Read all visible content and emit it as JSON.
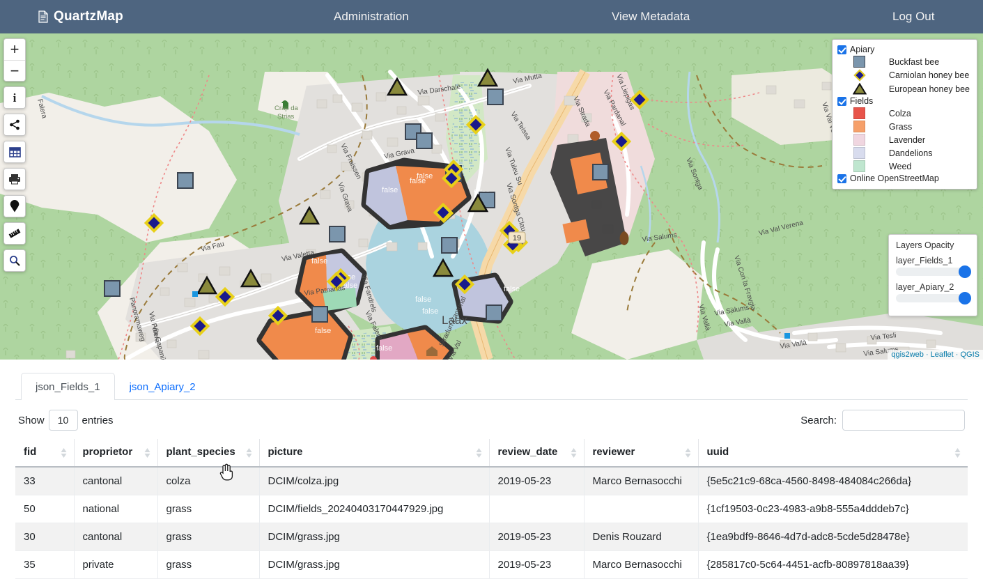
{
  "navbar": {
    "brand": "QuartzMap",
    "brand_icon": "document-icon",
    "links": [
      {
        "label": "Administration",
        "name": "nav-administration"
      },
      {
        "label": "View Metadata",
        "name": "nav-view-metadata"
      },
      {
        "label": "Log Out",
        "name": "nav-log-out"
      }
    ],
    "bg_color": "#4e6580"
  },
  "map": {
    "toolbar": [
      {
        "icon": "zoom-in-icon",
        "label": "+"
      },
      {
        "icon": "zoom-out-icon",
        "label": "−"
      },
      {
        "icon": "info-icon",
        "label": "i"
      },
      {
        "icon": "share-icon",
        "label": ""
      },
      {
        "icon": "attribute-table-icon",
        "label": ""
      },
      {
        "icon": "print-icon",
        "label": ""
      },
      {
        "icon": "marker-pin-icon",
        "label": ""
      },
      {
        "icon": "measure-ruler-icon",
        "label": ""
      },
      {
        "icon": "search-icon",
        "label": ""
      }
    ],
    "place_label": "Laax",
    "road_shield": "19",
    "feature_labels": [
      "false",
      "false",
      "false",
      "false",
      "false",
      "false",
      "false",
      "false",
      "false",
      "false",
      "false",
      "false",
      "false"
    ],
    "street_labels": [
      "Via Darschalè",
      "Via Mutta",
      "Via Teissa",
      "Via Tuleu Su",
      "Via Strada",
      "Via Liepigas",
      "Via Pardanal",
      "Via Sontga Clau",
      "Via Grava",
      "Via Fraissen",
      "Via Fandrels",
      "Via Falera",
      "Via Valetta",
      "Via Fau",
      "Via Capaniia",
      "Via Patnanas",
      "Via Crest",
      "Stradun Cantunal",
      "Via Val",
      "Via Salums",
      "Via Vallà",
      "Via Val Verena",
      "Via Con la Fravgia",
      "Via Tesli",
      "Falera",
      "Panoramaweg",
      "Crap da Strias",
      "Via Valetta",
      "Via Sontga"
    ],
    "attribution": {
      "qgis2web": "qgis2web",
      "leaflet": "Leaflet",
      "qgis": "QGIS",
      "sep": " · "
    }
  },
  "legend": {
    "groups": [
      {
        "name": "Apiary",
        "checked": true,
        "items": [
          {
            "label": "Buckfast bee",
            "symbol": "square",
            "color": "#7b96ad"
          },
          {
            "label": "Carniolan honey bee",
            "symbol": "diamond",
            "color": "#1a1a8c"
          },
          {
            "label": "European honey bee",
            "symbol": "triangle",
            "color": "#8a8a3c"
          }
        ]
      },
      {
        "name": "Fields",
        "checked": true,
        "items": [
          {
            "label": "Colza",
            "symbol": "fill",
            "color": "#e8544a"
          },
          {
            "label": "Grass",
            "symbol": "fill",
            "color": "#f6a06a"
          },
          {
            "label": "Lavender",
            "symbol": "fill",
            "color": "#f0d6e0"
          },
          {
            "label": "Dandelions",
            "symbol": "fill",
            "color": "#d8dcee"
          },
          {
            "label": "Weed",
            "symbol": "fill",
            "color": "#bfe6cf"
          }
        ]
      },
      {
        "name": "Online OpenStreetMap",
        "checked": true,
        "items": []
      }
    ],
    "checkbox_color": "#1a73e8"
  },
  "opacity_panel": {
    "title": "Layers Opacity",
    "sliders": [
      {
        "label": "layer_Fields_1",
        "value": 100
      },
      {
        "label": "layer_Apiary_2",
        "value": 100
      }
    ],
    "knob_color": "#1a73e8"
  },
  "table_panel": {
    "tabs": [
      {
        "label": "json_Fields_1",
        "active": true
      },
      {
        "label": "json_Apiary_2",
        "active": false
      }
    ],
    "length": {
      "prefix": "Show",
      "value": "10",
      "suffix": "entries"
    },
    "search": {
      "label": "Search:",
      "value": "",
      "placeholder": ""
    },
    "columns": [
      {
        "label": "fid",
        "sorted": false
      },
      {
        "label": "proprietor",
        "sorted": false
      },
      {
        "label": "plant_species",
        "sorted": false
      },
      {
        "label": "picture",
        "sorted": false
      },
      {
        "label": "review_date",
        "sorted": false
      },
      {
        "label": "reviewer",
        "sorted": false
      },
      {
        "label": "uuid",
        "sorted": false
      }
    ],
    "rows": [
      {
        "fid": "33",
        "proprietor": "cantonal",
        "plant_species": "colza",
        "picture": "DCIM/colza.jpg",
        "review_date": "2019-05-23",
        "reviewer": "Marco Bernasocchi",
        "uuid": "{5e5c21c9-68ca-4560-8498-484084c266da}"
      },
      {
        "fid": "50",
        "proprietor": "national",
        "plant_species": "grass",
        "picture": "DCIM/fields_20240403170447929.jpg",
        "review_date": "",
        "reviewer": "",
        "uuid": "{1cf19503-0c23-4983-a9b8-555a4dddeb7c}"
      },
      {
        "fid": "30",
        "proprietor": "cantonal",
        "plant_species": "grass",
        "picture": "DCIM/grass.jpg",
        "review_date": "2019-05-23",
        "reviewer": "Denis Rouzard",
        "uuid": "{1ea9bdf9-8646-4d7d-adc8-5cde5d28478e}"
      },
      {
        "fid": "35",
        "proprietor": "private",
        "plant_species": "grass",
        "picture": "DCIM/grass.jpg",
        "review_date": "2019-05-23",
        "reviewer": "Marco Bernasocchi",
        "uuid": "{285817c0-5c64-4451-acfb-80897818aa39}"
      }
    ]
  }
}
